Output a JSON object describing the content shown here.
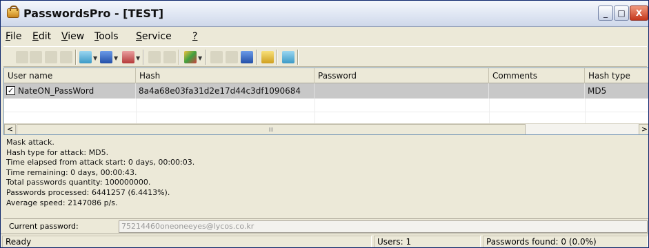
{
  "window": {
    "title": "PasswordsPro - [TEST]",
    "minimize_glyph": "_",
    "maximize_glyph": "□",
    "close_glyph": "X"
  },
  "menu": [
    {
      "label": "File",
      "underline": "F",
      "rest": "ile"
    },
    {
      "label": "Edit",
      "underline": "E",
      "rest": "dit"
    },
    {
      "label": "View",
      "underline": "V",
      "rest": "iew"
    },
    {
      "label": "Tools",
      "underline": "T",
      "rest": "ools"
    },
    {
      "label": "Service",
      "underline": "S",
      "rest": "ervice"
    },
    {
      "label": "?",
      "underline": "?",
      "rest": ""
    }
  ],
  "toolbar_icons": [
    "new-icon",
    "open-icon",
    "save-icon",
    "save-as-icon",
    "copy-icon",
    "find-icon",
    "remove-icon",
    "import-icon",
    "export-icon",
    "attack-icon",
    "start-icon",
    "continue-icon",
    "pause-icon",
    "options-icon",
    "update-icon"
  ],
  "grid": {
    "columns": [
      "User name",
      "Hash",
      "Password",
      "Comments",
      "Hash type"
    ],
    "rows": [
      {
        "checked": true,
        "check_glyph": "✓",
        "user_name": "NateON_PassWord",
        "hash": "8a4a68e03fa31d2e17d44c3df1090684",
        "password": "",
        "comments": "",
        "hash_type": "MD5"
      }
    ],
    "scroll_left": "<",
    "scroll_right": ">",
    "scroll_grip": "III"
  },
  "log": [
    "Mask attack.",
    "Hash type for attack: MD5.",
    "Time elapsed from attack start: 0 days, 00:00:03.",
    "Time remaining: 0 days, 00:00:43.",
    "Total passwords quantity: 100000000.",
    "Passwords processed: 6441257 (6.4413%).",
    "Average speed: 2147086 p/s."
  ],
  "current_password": {
    "label": "Current password:",
    "value": "75214460oneoneeyes@lycos.co.kr"
  },
  "status": {
    "state": "Ready",
    "users": "Users: 1",
    "found": "Passwords found: 0 (0.0%)"
  }
}
